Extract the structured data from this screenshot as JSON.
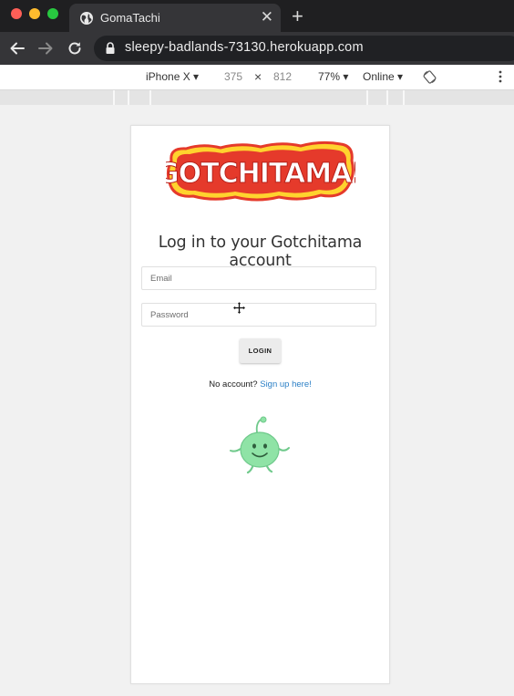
{
  "browser": {
    "tab_title": "GomaTachi",
    "tab_close": "✕",
    "new_tab": "+",
    "url": "sleepy-badlands-73130.herokuapp.com"
  },
  "devtools": {
    "device": "iPhone X ▾",
    "width": "375",
    "times": "×",
    "height": "812",
    "zoom": "77% ▾",
    "network": "Online ▾"
  },
  "page": {
    "logo_text": "GOTCHITAMA!",
    "heading": "Log in to your Gotchitama account",
    "email_placeholder": "Email",
    "password_placeholder": "Password",
    "login_label": "LOGIN",
    "no_account_text": "No account?",
    "signup_link": "Sign up here!"
  },
  "colors": {
    "logo_red": "#e53a2b",
    "logo_yellow": "#ffd32e",
    "mascot_green": "#8fe3a6",
    "link_blue": "#2a7fc6"
  }
}
